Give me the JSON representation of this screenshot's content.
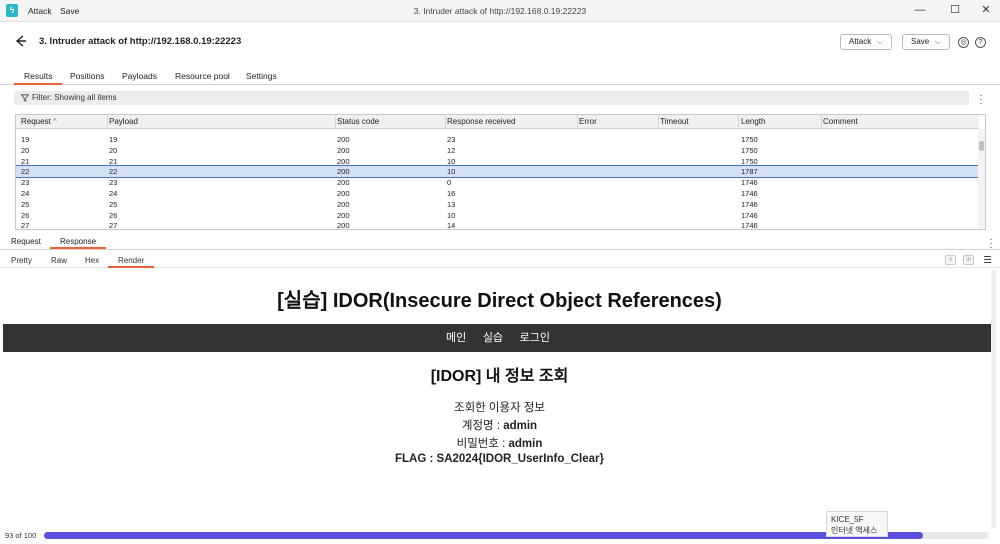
{
  "titlebar": {
    "menu": [
      "Attack",
      "Save"
    ],
    "title": "3. Intruder attack of http://192.168.0.19:22223",
    "controls": {
      "minimize": "—",
      "maximize": "☐",
      "close": "✕"
    }
  },
  "header": {
    "title": "3. Intruder attack of http://192.168.0.19:22223",
    "attack_btn": "Attack",
    "save_btn": "Save",
    "settings_glyph": "◎",
    "help_glyph": "?"
  },
  "tabs": [
    "Results",
    "Positions",
    "Payloads",
    "Resource pool",
    "Settings"
  ],
  "filter": {
    "text": "Filter: Showing all items"
  },
  "table": {
    "columns": [
      "Request",
      "Payload",
      "Status code",
      "Response received",
      "Error",
      "Timeout",
      "Length",
      "Comment"
    ],
    "sort_glyph": "^",
    "rows": [
      [
        "19",
        "19",
        "200",
        "23",
        "",
        "",
        "1750",
        ""
      ],
      [
        "20",
        "20",
        "200",
        "12",
        "",
        "",
        "1750",
        ""
      ],
      [
        "21",
        "21",
        "200",
        "10",
        "",
        "",
        "1750",
        ""
      ],
      [
        "22",
        "22",
        "200",
        "10",
        "",
        "",
        "1787",
        ""
      ],
      [
        "23",
        "23",
        "200",
        "0",
        "",
        "",
        "1746",
        ""
      ],
      [
        "24",
        "24",
        "200",
        "16",
        "",
        "",
        "1746",
        ""
      ],
      [
        "25",
        "25",
        "200",
        "13",
        "",
        "",
        "1746",
        ""
      ],
      [
        "26",
        "26",
        "200",
        "10",
        "",
        "",
        "1746",
        ""
      ],
      [
        "27",
        "27",
        "200",
        "14",
        "",
        "",
        "1746",
        ""
      ]
    ],
    "selected_index": 3
  },
  "rr_tabs": [
    "Request",
    "Response"
  ],
  "view_tabs": [
    "Pretty",
    "Raw",
    "Hex",
    "Render"
  ],
  "view_tools": [
    "≡",
    "\\n"
  ],
  "render": {
    "h1": "[실습] IDOR(Insecure Direct Object References)",
    "nav": [
      "메인",
      "실습",
      "로그인"
    ],
    "h2": "[IDOR] 내 정보 조회",
    "caption": "조회한 이용자 정보",
    "account_label": "계정명 : ",
    "account_value": "admin",
    "password_label": "비밀번호 : ",
    "password_value": "admin",
    "flag_label": "FLAG : ",
    "flag_value": "SA2024{IDOR_UserInfo_Clear}"
  },
  "progress": {
    "text": "93 of 100",
    "fraction": 0.93
  },
  "tooltip": {
    "line1": "KICE_5F",
    "line2": "인터넷 액세스"
  },
  "colors": {
    "accent": "#e8613a",
    "progress": "#5b4fe0",
    "nav_bg": "#333333",
    "selected_row": "#d3e1f5"
  }
}
